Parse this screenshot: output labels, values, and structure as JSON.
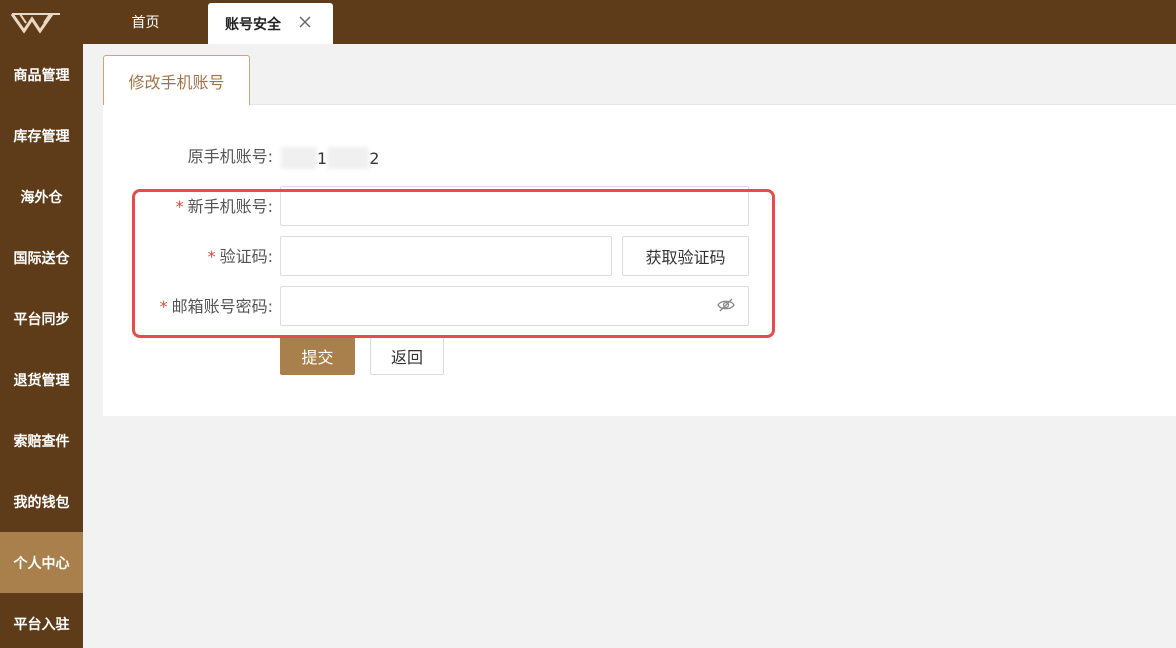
{
  "logo": {
    "icon": "w-logo-icon"
  },
  "topbar": {
    "tabs": [
      {
        "label": "首页"
      },
      {
        "label": "账号安全",
        "active": true
      }
    ]
  },
  "sidebar": {
    "items": [
      {
        "label": "商品管理"
      },
      {
        "label": "库存管理"
      },
      {
        "label": "海外仓"
      },
      {
        "label": "国际送仓"
      },
      {
        "label": "平台同步"
      },
      {
        "label": "退货管理"
      },
      {
        "label": "索赔查件"
      },
      {
        "label": "我的钱包"
      },
      {
        "label": "个人中心",
        "active": true
      },
      {
        "label": "平台入驻"
      }
    ]
  },
  "content": {
    "sub_tab": "修改手机账号",
    "form": {
      "original_label": "原手机账号:",
      "original_value_start": "1",
      "original_value_end": "2",
      "new_phone_label": "新手机账号:",
      "new_phone_value": "",
      "code_label": "验证码:",
      "code_value": "",
      "get_code_button": "获取验证码",
      "password_label": "邮箱账号密码:",
      "password_value": "",
      "required_mark": "*"
    },
    "buttons": {
      "submit": "提交",
      "back": "返回"
    }
  },
  "colors": {
    "sidebar_bg": "#5f3c19",
    "active_bg": "#a97f4c",
    "accent": "#a0744a",
    "required": "#e0473c",
    "highlight": "#e94b4b"
  }
}
